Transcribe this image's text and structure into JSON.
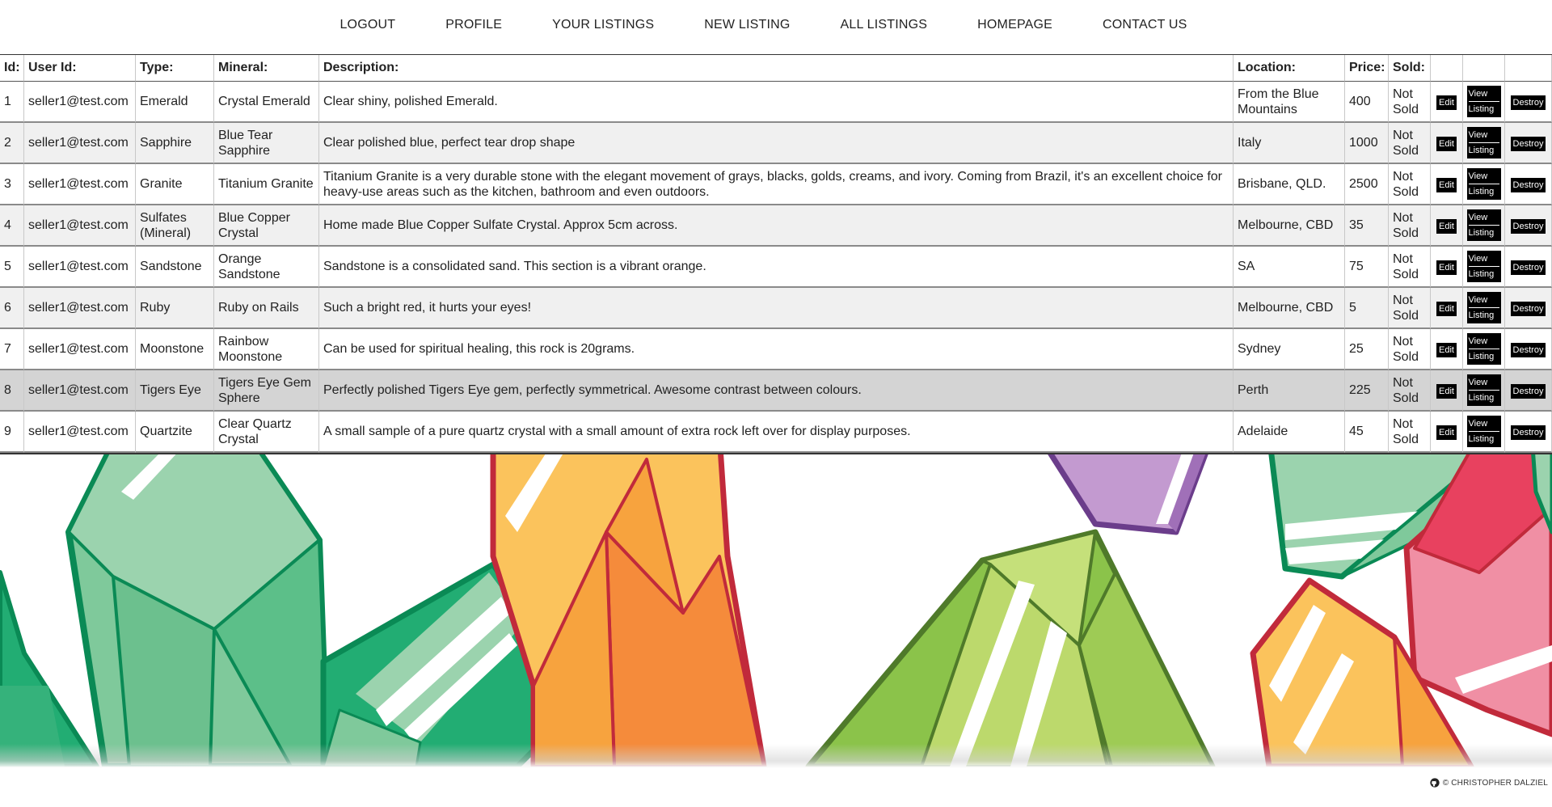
{
  "nav": {
    "items": [
      {
        "label": "LOGOUT",
        "name": "nav-logout"
      },
      {
        "label": "PROFILE",
        "name": "nav-profile"
      },
      {
        "label": "YOUR LISTINGS",
        "name": "nav-your-listings"
      },
      {
        "label": "NEW LISTING",
        "name": "nav-new-listing"
      },
      {
        "label": "ALL LISTINGS",
        "name": "nav-all-listings"
      },
      {
        "label": "HOMEPAGE",
        "name": "nav-homepage"
      },
      {
        "label": "CONTACT US",
        "name": "nav-contact-us"
      }
    ]
  },
  "table": {
    "headers": {
      "id": "Id:",
      "user": "User Id:",
      "type": "Type:",
      "mineral": "Mineral:",
      "description": "Description:",
      "location": "Location:",
      "price": "Price:",
      "sold": "Sold:"
    },
    "actions": {
      "edit": "Edit",
      "view_line1": "View",
      "view_line2": "Listing",
      "destroy": "Destroy"
    },
    "rows": [
      {
        "id": "1",
        "user": "seller1@test.com",
        "type": "Emerald",
        "mineral": "Crystal Emerald",
        "description": "Clear shiny, polished Emerald.",
        "location": "From the Blue Mountains",
        "price": "400",
        "sold": "Not Sold"
      },
      {
        "id": "2",
        "user": "seller1@test.com",
        "type": "Sapphire",
        "mineral": "Blue Tear Sapphire",
        "description": "Clear polished blue, perfect tear drop shape",
        "location": "Italy",
        "price": "1000",
        "sold": "Not Sold"
      },
      {
        "id": "3",
        "user": "seller1@test.com",
        "type": "Granite",
        "mineral": "Titanium Granite",
        "description": "Titanium Granite is a very durable stone with the elegant movement of grays, blacks, golds, creams, and ivory. Coming from Brazil, it's an excellent choice for heavy-use areas such as the kitchen, bathroom and even outdoors.",
        "location": "Brisbane, QLD.",
        "price": "2500",
        "sold": "Not Sold"
      },
      {
        "id": "4",
        "user": "seller1@test.com",
        "type": "Sulfates (Mineral)",
        "mineral": "Blue Copper Crystal",
        "description": "Home made Blue Copper Sulfate Crystal. Approx 5cm across.",
        "location": "Melbourne, CBD",
        "price": "35",
        "sold": "Not Sold"
      },
      {
        "id": "5",
        "user": "seller1@test.com",
        "type": "Sandstone",
        "mineral": "Orange Sandstone",
        "description": "Sandstone is a consolidated sand. This section is a vibrant orange.",
        "location": "SA",
        "price": "75",
        "sold": "Not Sold"
      },
      {
        "id": "6",
        "user": "seller1@test.com",
        "type": "Ruby",
        "mineral": "Ruby on Rails",
        "description": "Such a bright red, it hurts your eyes!",
        "location": "Melbourne, CBD",
        "price": "5",
        "sold": "Not Sold"
      },
      {
        "id": "7",
        "user": "seller1@test.com",
        "type": "Moonstone",
        "mineral": "Rainbow Moonstone",
        "description": "Can be used for spiritual healing, this rock is 20grams.",
        "location": "Sydney",
        "price": "25",
        "sold": "Not Sold"
      },
      {
        "id": "8",
        "user": "seller1@test.com",
        "type": "Tigers Eye",
        "mineral": "Tigers Eye Gem Sphere",
        "description": "Perfectly polished Tigers Eye gem, perfectly symmetrical. Awesome contrast between colours.",
        "location": "Perth",
        "price": "225",
        "sold": "Not Sold"
      },
      {
        "id": "9",
        "user": "seller1@test.com",
        "type": "Quartzite",
        "mineral": "Clear Quartz Crystal",
        "description": "A small sample of a pure quartz crystal with a small amount of extra rock left over for display purposes.",
        "location": "Adelaide",
        "price": "45",
        "sold": "Not Sold"
      }
    ]
  },
  "footer": {
    "text": "© CHRISTOPHER DALZIEL",
    "icon": "github-icon"
  },
  "colors": {
    "green_dark": "#0a8a55",
    "green_mid": "#5cbf89",
    "green_light": "#9bd3ae",
    "orange": "#f7a33e",
    "orange_light": "#fbc35c",
    "red_outline": "#c12a3b",
    "lime": "#8bc34a",
    "lime_light": "#c5e07a",
    "purple": "#c39ad0",
    "pink": "#f08fa4"
  }
}
